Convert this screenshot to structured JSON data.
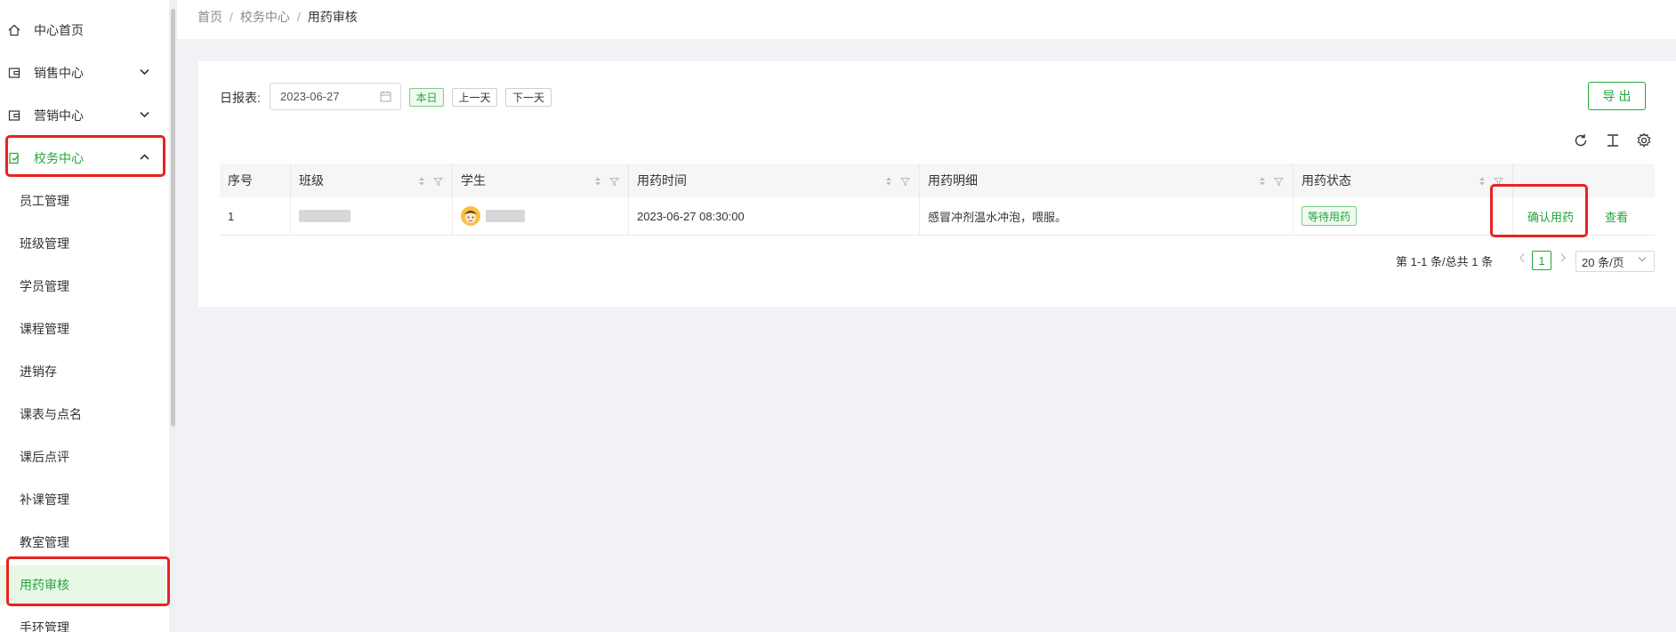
{
  "sidebar": {
    "items": [
      {
        "label": "中心首页",
        "icon": "home-icon"
      },
      {
        "label": "销售中心",
        "icon": "wallet-icon"
      },
      {
        "label": "营销中心",
        "icon": "wallet-icon"
      },
      {
        "label": "校务中心",
        "icon": "school-icon"
      },
      {
        "label": "员工管理"
      },
      {
        "label": "班级管理"
      },
      {
        "label": "学员管理"
      },
      {
        "label": "课程管理"
      },
      {
        "label": "进销存"
      },
      {
        "label": "课表与点名"
      },
      {
        "label": "课后点评"
      },
      {
        "label": "补课管理"
      },
      {
        "label": "教室管理"
      },
      {
        "label": "用药审核"
      },
      {
        "label": "手环管理"
      }
    ],
    "active_label": "用药审核"
  },
  "breadcrumb": {
    "home": "首页",
    "parent": "校务中心",
    "current": "用药审核",
    "separator": "/"
  },
  "toolbar": {
    "date_label": "日报表:",
    "date_value": "2023-06-27",
    "today": "本日",
    "prev_day": "上一天",
    "next_day": "下一天",
    "export": "导 出"
  },
  "table": {
    "columns": [
      "序号",
      "班级",
      "学生",
      "用药时间",
      "用药明细",
      "用药状态"
    ],
    "rows": [
      {
        "index": "1",
        "time": "2023-06-27 08:30:00",
        "detail": "感冒冲剂温水冲泡，喂服。",
        "status": "等待用药",
        "action_confirm": "确认用药",
        "action_view": "查看"
      }
    ]
  },
  "pagination": {
    "total_text": "第 1-1 条/总共 1 条",
    "current_page": "1",
    "page_size": "20 条/页"
  },
  "colors": {
    "accent": "#23a53d",
    "highlight_box": "#e8231d",
    "active_bg": "#e8f7e6"
  }
}
